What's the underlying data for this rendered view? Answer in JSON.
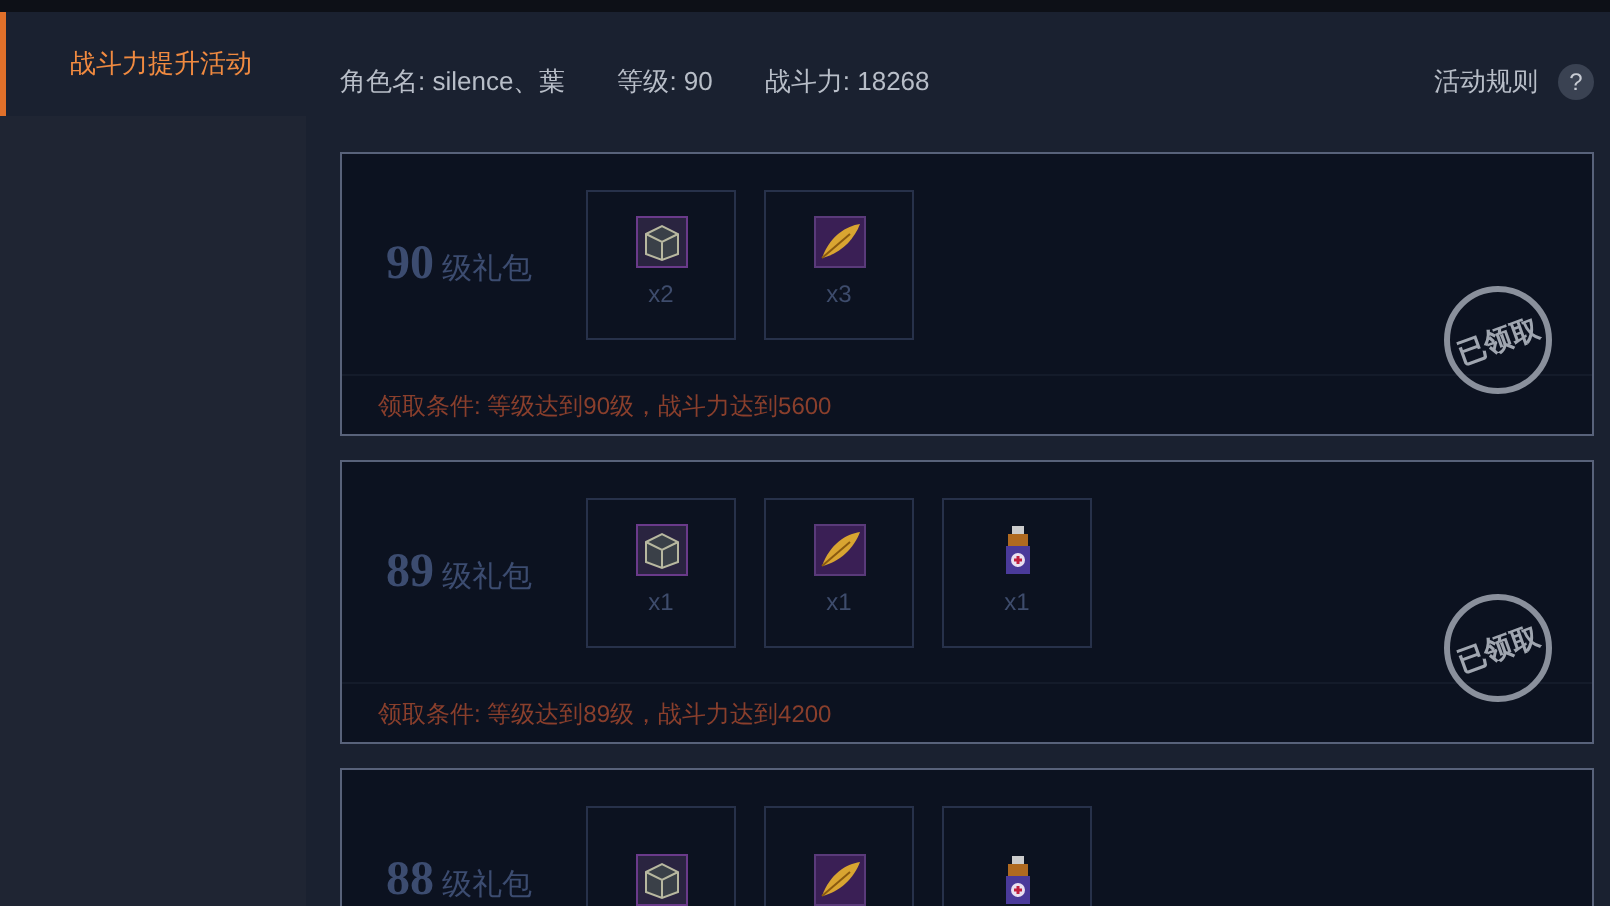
{
  "sidebar": {
    "items": [
      {
        "label": "战斗力提升活动",
        "selected": true
      }
    ]
  },
  "header": {
    "name_label": "角色名: silence、葉",
    "level_label": "等级: 90",
    "power_label": "战斗力: 18268",
    "rules_link": "活动规则",
    "help_icon": "?"
  },
  "packages": [
    {
      "level": "90",
      "title": "级礼包",
      "items": [
        {
          "kind": "chest",
          "count": "x2"
        },
        {
          "kind": "feather",
          "count": "x3"
        }
      ],
      "condition": "领取条件: 等级达到90级，战斗力达到5600",
      "stamp": "已领取"
    },
    {
      "level": "89",
      "title": "级礼包",
      "items": [
        {
          "kind": "chest",
          "count": "x1"
        },
        {
          "kind": "feather",
          "count": "x1"
        },
        {
          "kind": "potion",
          "count": "x1"
        }
      ],
      "condition": "领取条件: 等级达到89级，战斗力达到4200",
      "stamp": "已领取"
    },
    {
      "level": "88",
      "title": "级礼包",
      "items": [
        {
          "kind": "chest"
        },
        {
          "kind": "feather"
        },
        {
          "kind": "potion"
        }
      ]
    }
  ]
}
